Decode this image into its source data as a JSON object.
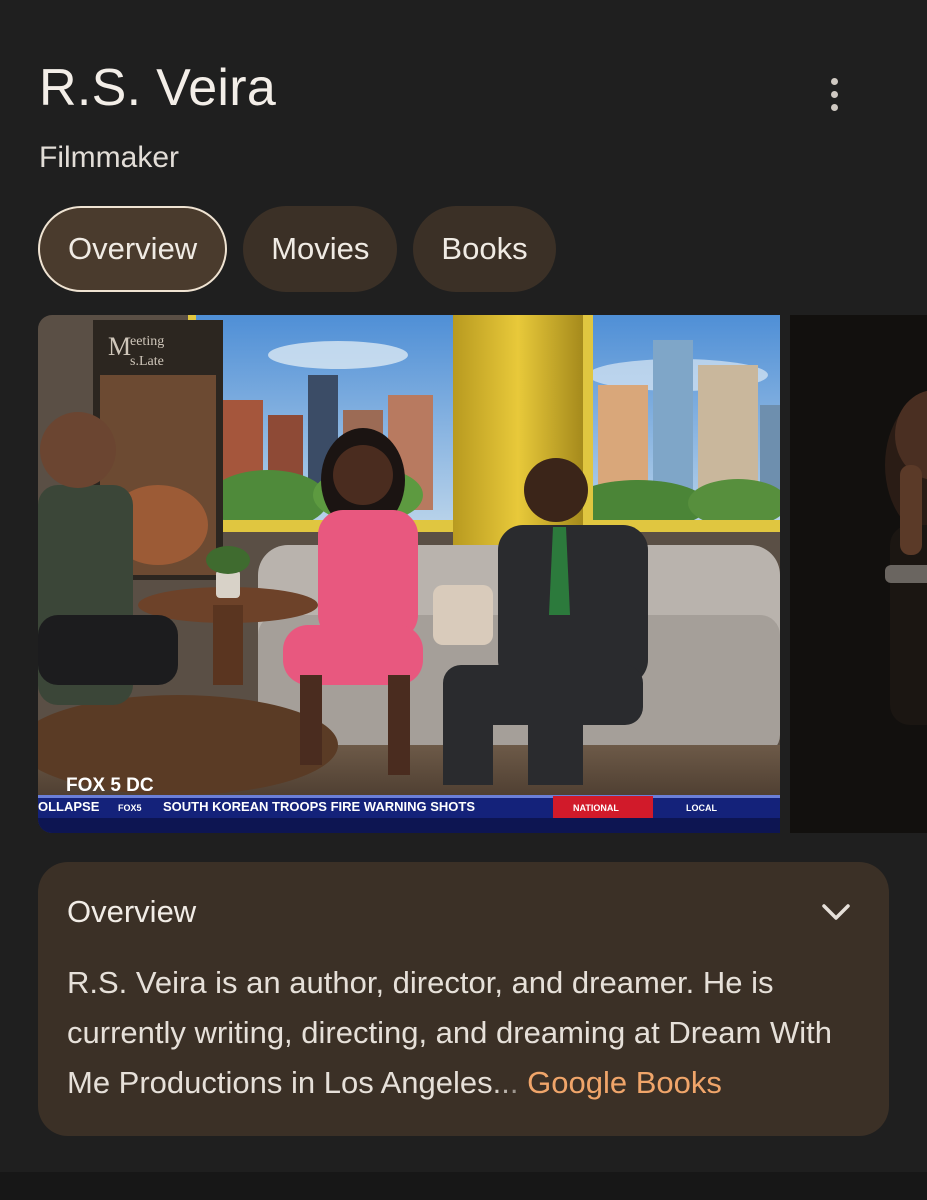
{
  "header": {
    "title": "R.S. Veira",
    "subtitle": "Filmmaker",
    "menu_icon": "more-vert-icon"
  },
  "tabs": [
    {
      "label": "Overview",
      "active": true
    },
    {
      "label": "Movies",
      "active": false
    },
    {
      "label": "Books",
      "active": false
    }
  ],
  "media": {
    "main_image": {
      "watermark": "FOX 5 DC",
      "poster_text": "Meeting Ms. Late",
      "ticker": {
        "lead": "OLLAPSE",
        "logo": "FOX5",
        "headline": "SOUTH KOREAN TROOPS FIRE WARNING SHOTS",
        "tag_national": "NATIONAL",
        "tag_local": "LOCAL"
      }
    }
  },
  "overview": {
    "title": "Overview",
    "chevron_icon": "chevron-down-icon",
    "text_main": "R.S. Veira is an author, director, and dreamer. He is currently writing, directing, and dreaming at Dream With Me Productions in Los Ange",
    "text_faded": "les...",
    "source_link": "Google Books"
  },
  "colors": {
    "background": "#1f1f1f",
    "chip": "#3b3026",
    "chip_active_border": "#efe3d2",
    "link": "#f0a56a"
  }
}
